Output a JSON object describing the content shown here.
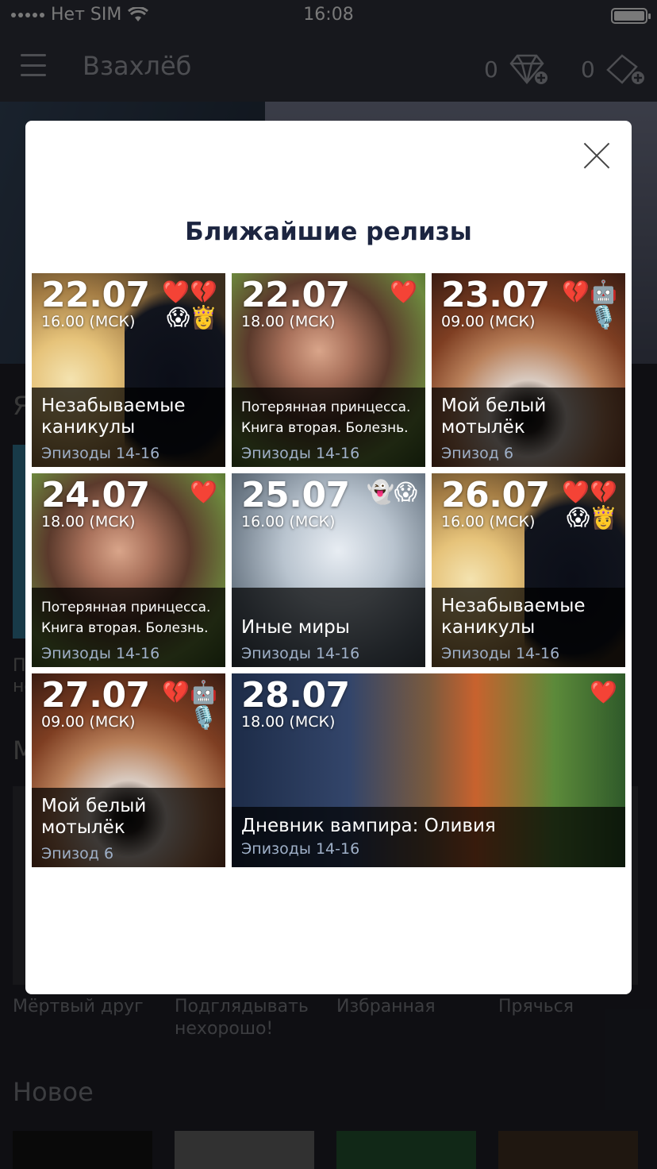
{
  "status": {
    "carrier": "Нет SIM",
    "time": "16:08"
  },
  "app": {
    "title": "Взахлёб",
    "gems": "0",
    "tickets": "0",
    "icons": {
      "menu": "hamburger-icon",
      "gems": "diamond-plus-icon",
      "tickets": "ticket-plus-icon"
    }
  },
  "background": {
    "section_ya": "Я",
    "p_text": "П\nне",
    "section_m": "М",
    "row_titles": [
      "Мёртвый друг",
      "Подглядывать нехорошо!",
      "Избранная",
      "Прячься"
    ],
    "section_new": "Новое"
  },
  "modal": {
    "title": "Ближайшие релизы",
    "releases": [
      {
        "date": "22.07",
        "time": "16.00 (МСК)",
        "emoji": "❤️💔😱👸",
        "title": "Незабываемые каникулы",
        "episodes": "Эпизоды 14-16"
      },
      {
        "date": "22.07",
        "time": "18.00 (МСК)",
        "emoji": "❤️",
        "title": "Потерянная принцесса. Книга вторая. Болезнь.",
        "episodes": "Эпизоды 14-16"
      },
      {
        "date": "23.07",
        "time": "09.00 (МСК)",
        "emoji": "💔🤖🎙️",
        "title": "Мой белый мотылёк",
        "episodes": "Эпизод 6"
      },
      {
        "date": "24.07",
        "time": "18.00 (МСК)",
        "emoji": "❤️",
        "title": "Потерянная принцесса. Книга вторая. Болезнь.",
        "episodes": "Эпизоды 14-16"
      },
      {
        "date": "25.07",
        "time": "16.00 (МСК)",
        "emoji": "👻😱",
        "title": "Иные миры",
        "episodes": "Эпизоды 14-16"
      },
      {
        "date": "26.07",
        "time": "16.00 (МСК)",
        "emoji": "❤️💔😱👸",
        "title": "Незабываемые каникулы",
        "episodes": "Эпизоды 14-16"
      },
      {
        "date": "27.07",
        "time": "09.00 (МСК)",
        "emoji": "💔🤖🎙️",
        "title": "Мой белый мотылёк",
        "episodes": "Эпизод 6"
      },
      {
        "date": "28.07",
        "time": "18.00 (МСК)",
        "emoji": "❤️",
        "title": "Дневник вампира: Оливия",
        "episodes": "Эпизоды 14-16"
      }
    ]
  }
}
